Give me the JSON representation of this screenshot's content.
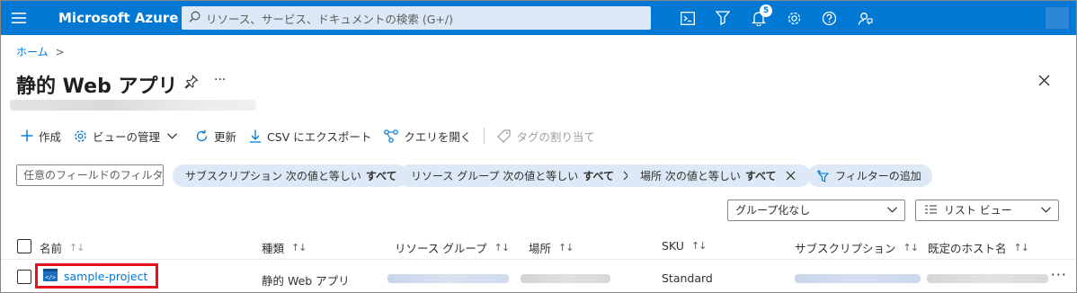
{
  "topbar": {
    "brand": "Microsoft Azure",
    "search_placeholder": "リソース、サービス、ドキュメントの検索 (G+/)",
    "notification_count": "5",
    "bg_color": "#0078d4"
  },
  "breadcrumb": {
    "home": "ホーム",
    "separator": ">"
  },
  "page": {
    "title": "静的 Web アプリ",
    "more": "···"
  },
  "toolbar": {
    "create": "作成",
    "manage_view": "ビューの管理",
    "refresh": "更新",
    "export_csv": "CSV にエクスポート",
    "open_query": "クエリを開く",
    "assign_tags": "タグの割り当て"
  },
  "filters": {
    "input_placeholder": "任意のフィールドのフィルター...",
    "subscription_label": "サブスクリプション 次の値と等しい",
    "subscription_value": "すべて",
    "resource_group_label": "リソース グループ 次の値と等しい",
    "resource_group_value": "すべて",
    "location_label": "場所 次の値と等しい",
    "location_value": "すべて",
    "add_filter": "フィルターの追加"
  },
  "view": {
    "grouping": "グループ化なし",
    "list_view": "リスト ビュー"
  },
  "table": {
    "columns": [
      "名前",
      "種類",
      "リソース グループ",
      "場所",
      "SKU",
      "サブスクリプション",
      "既定のホスト名"
    ],
    "sort_glyph": "↑↓",
    "rows": [
      {
        "name": "sample-project",
        "type": "静的 Web アプリ",
        "sku": "Standard",
        "more": "···"
      }
    ]
  }
}
